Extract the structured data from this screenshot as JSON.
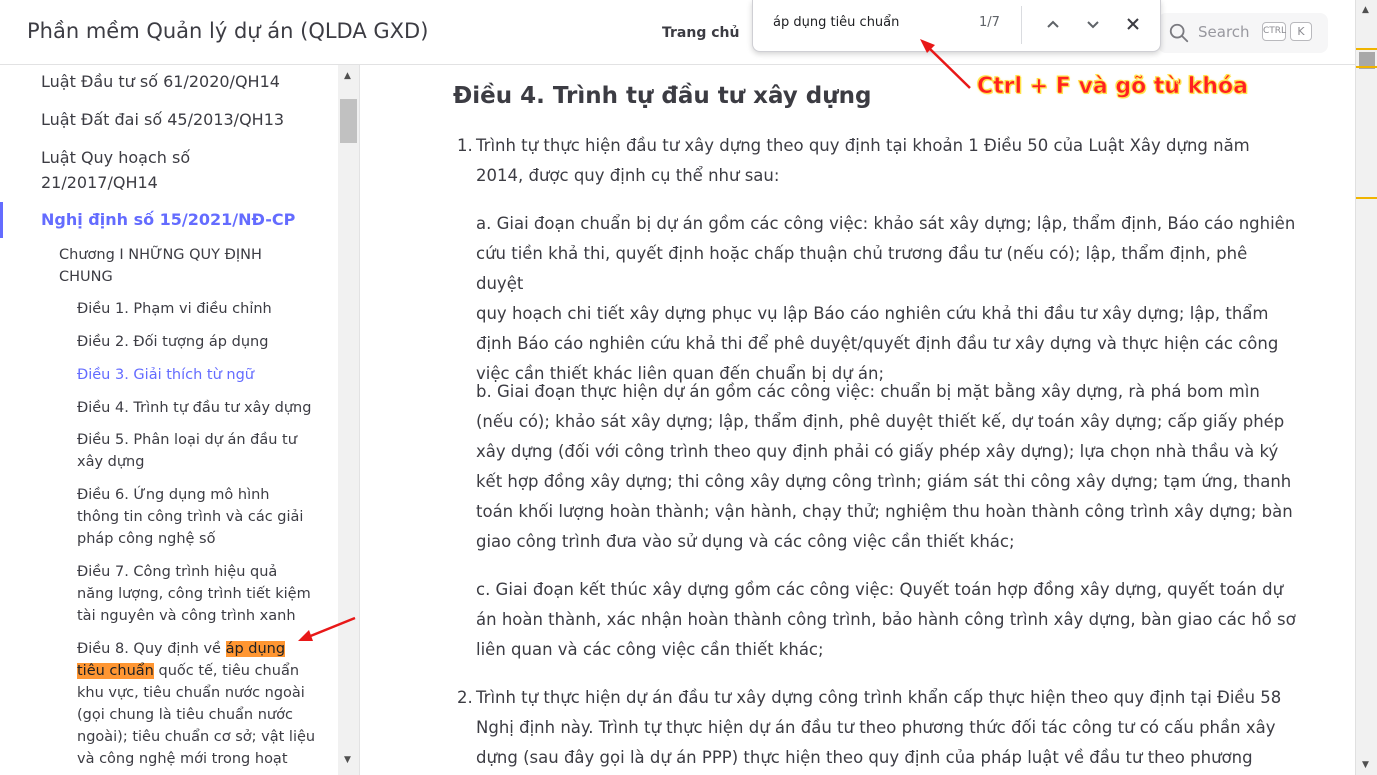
{
  "header": {
    "title": "Phần mềm Quản lý dự án (QLDA GXD)",
    "nav_home": "Trang chủ",
    "search_placeholder": "Search",
    "kbd_ctrl": "CTRL",
    "kbd_k": "K"
  },
  "findbar": {
    "query": "áp dụng tiêu chuẩn",
    "count": "1/7"
  },
  "annotation": {
    "top_label": "Ctrl + F và gõ từ khóa",
    "color": "#ff2020"
  },
  "sidebar": {
    "items": [
      {
        "label": "Luật Đầu tư số 61/2020/QH14"
      },
      {
        "label": "Luật Đất đai số 45/2013/QH13"
      },
      {
        "label": "Luật Quy hoạch số",
        "label2": "21/2017/QH14"
      },
      {
        "label": "Nghị định số 15/2021/NĐ-CP"
      },
      {
        "label": "Chương I NHỮNG QUY ĐỊNH",
        "label2": "CHUNG"
      },
      {
        "label": "Điều 1. Phạm vi điều chỉnh"
      },
      {
        "label": "Điều 2. Đối tượng áp dụng"
      },
      {
        "label": "Điều 3. Giải thích từ ngữ"
      },
      {
        "label": "Điều 4. Trình tự đầu tư xây dựng"
      },
      {
        "label": "Điều 5. Phân loại dự án đầu tư",
        "label2": "xây dựng"
      },
      {
        "label": "Điều 6. Ứng dụng mô hình",
        "label2": "thông tin công trình và các giải",
        "label3": "pháp công nghệ số"
      },
      {
        "label": "Điều 7. Công trình hiệu quả",
        "label2": "năng lượng, công trình tiết kiệm",
        "label3": "tài nguyên và công trình xanh"
      },
      {
        "prefix": "Điều 8. Quy định về ",
        "hl1": "áp dụng",
        "hl2": "tiêu chuẩn",
        "rest1": " quốc tế, tiêu chuẩn",
        "l3": "khu vực, tiêu chuẩn nước ngoài",
        "l4": "(gọi chung là tiêu chuẩn nước",
        "l5": "ngoài); tiêu chuẩn cơ sở; vật liệu",
        "l6": "và công nghệ mới trong hoạt"
      }
    ]
  },
  "content": {
    "heading": "Điều 4. Trình tự đầu tư xây dựng",
    "item1_num": "1.",
    "item1": [
      "Trình tự thực hiện đầu tư xây dựng theo quy định tại khoản 1 Điều 50 của Luật Xây dựng năm",
      "2014, được quy định cụ thể như sau:"
    ],
    "a": [
      "a. Giai đoạn chuẩn bị dự án gồm các công việc: khảo sát xây dựng; lập, thẩm định, Báo cáo nghiên",
      "cứu tiền khả thi, quyết định hoặc chấp thuận chủ trương đầu tư (nếu có); lập, thẩm định, phê duyệt",
      "quy hoạch chi tiết xây dựng phục vụ lập Báo cáo nghiên cứu khả thi đầu tư xây dựng; lập, thẩm",
      "định Báo cáo nghiên cứu khả thi để phê duyệt/quyết định đầu tư xây dựng và thực hiện các công",
      "việc cần thiết khác liên quan đến chuẩn bị dự án;"
    ],
    "b": [
      "b. Giai đoạn thực hiện dự án gồm các công việc: chuẩn bị mặt bằng xây dựng, rà phá bom mìn",
      "(nếu có); khảo sát xây dựng; lập, thẩm định, phê duyệt thiết kế, dự toán xây dựng; cấp giấy phép",
      "xây dựng (đối với công trình theo quy định phải có giấy phép xây dựng); lựa chọn nhà thầu và ký",
      "kết hợp đồng xây dựng; thi công xây dựng công trình; giám sát thi công xây dựng; tạm ứng, thanh",
      "toán khối lượng hoàn thành; vận hành, chạy thử; nghiệm thu hoàn thành công trình xây dựng; bàn",
      "giao công trình đưa vào sử dụng và các công việc cần thiết khác;"
    ],
    "c": [
      "c. Giai đoạn kết thúc xây dựng gồm các công việc: Quyết toán hợp đồng xây dựng, quyết toán dự",
      "án hoàn thành, xác nhận hoàn thành công trình, bảo hành công trình xây dựng, bàn giao các hồ sơ",
      "liên quan và các công việc cần thiết khác;"
    ],
    "item2_num": "2.",
    "item2": [
      "Trình tự thực hiện dự án đầu tư xây dựng công trình khẩn cấp thực hiện theo quy định tại Điều 58",
      "Nghị định này. Trình tự thực hiện dự án đầu tư theo phương thức đối tác công tư có cấu phần xây",
      "dựng (sau đây gọi là dự án PPP) thực hiện theo quy định của pháp luật về đầu tư theo phương"
    ]
  },
  "colors": {
    "brand": "#646cff",
    "highlight": "#ff9632",
    "annotation": "#ff2020"
  }
}
